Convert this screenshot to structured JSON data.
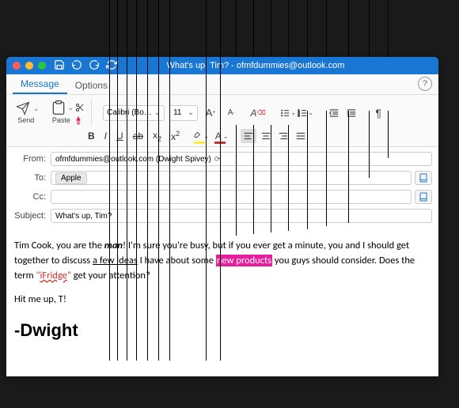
{
  "title": "What's up, Tim? - ofmfdummies@outlook.com",
  "tabs": {
    "message": "Message",
    "options": "Options"
  },
  "ribbon": {
    "send": "Send",
    "paste": "Paste",
    "font": "Calibri (Bo…",
    "size": "11",
    "incFont": "A⁺",
    "decFont": "A⁻"
  },
  "fields": {
    "from_label": "From:",
    "from_value": "ofmfdummies@outlook.com (Dwight Spivey)",
    "to_label": "To:",
    "to_value": "Apple",
    "cc_label": "Cc:",
    "cc_value": "",
    "subject_label": "Subject:",
    "subject_value": "What's up, Tim?"
  },
  "body": {
    "p1a": "Tim Cook, you are the ",
    "p1b": "man",
    "p1c": "! I'm sure you're busy, but if you ever get a minute, you and I should get together to discuss ",
    "p1d": "a few ideas",
    "p1e": " I have about some ",
    "p1f": "new products",
    "p1g": " you guys should consider. Does the term ",
    "p1h": "\"",
    "p1i": "iFridge",
    "p1j": "\"",
    "p1k": " get your attention?",
    "p2": "Hit me up, T!",
    "sign": "-Dwight"
  }
}
